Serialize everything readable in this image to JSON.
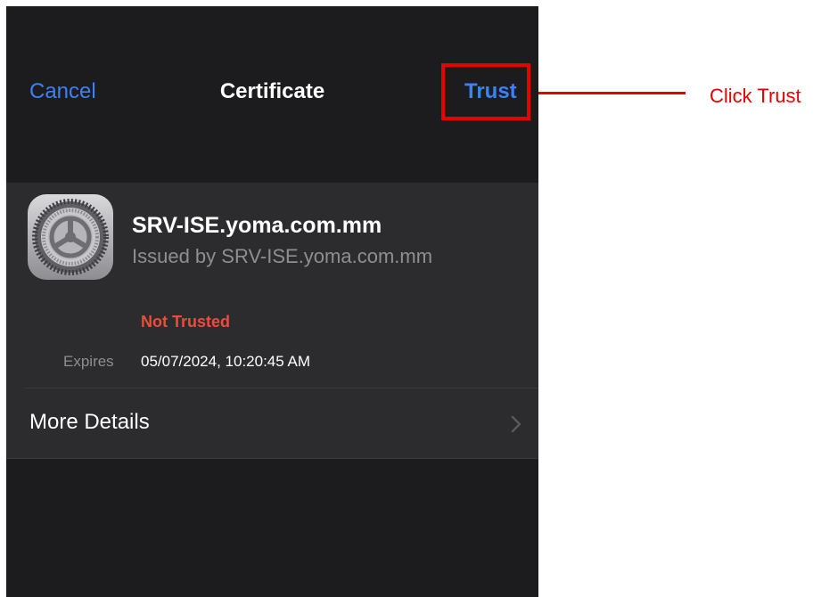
{
  "navbar": {
    "cancel_label": "Cancel",
    "title": "Certificate",
    "trust_label": "Trust"
  },
  "certificate": {
    "icon": "settings-gear-icon",
    "name": "SRV-ISE.yoma.com.mm",
    "issuer": "Issued by SRV-ISE.yoma.com.mm",
    "status": "Not Trusted",
    "expires_label": "Expires",
    "expires_value": "05/07/2024, 10:20:45 AM"
  },
  "more_details": {
    "label": "More Details",
    "icon": "chevron-right-icon"
  },
  "annotation": {
    "callout_text": "Click Trust",
    "color": "#e60000"
  },
  "colors": {
    "background": "#1c1c1e",
    "card": "#2c2c2e",
    "accent": "#3a82f7",
    "status_red": "#eb4d3d"
  }
}
